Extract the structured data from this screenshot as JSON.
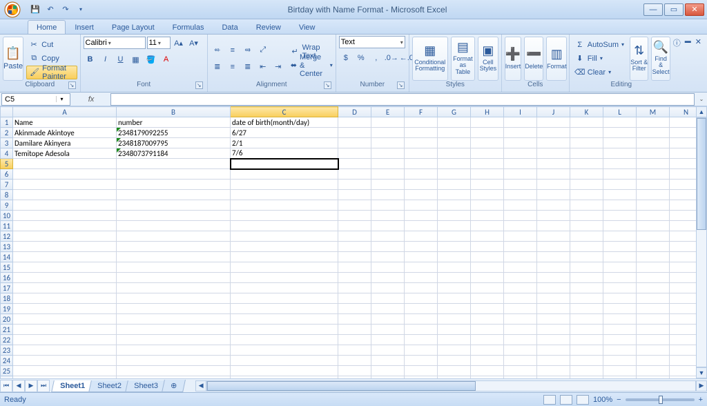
{
  "window": {
    "title": "Birtday with Name Format - Microsoft Excel"
  },
  "qat": {
    "save": "💾",
    "undo": "↶",
    "redo": "↷"
  },
  "tabs": [
    "Home",
    "Insert",
    "Page Layout",
    "Formulas",
    "Data",
    "Review",
    "View"
  ],
  "active_tab": "Home",
  "ribbon": {
    "clipboard": {
      "paste": "Paste",
      "cut": "Cut",
      "copy": "Copy",
      "format_painter": "Format Painter",
      "label": "Clipboard"
    },
    "font": {
      "name": "Calibri",
      "size": "11",
      "label": "Font"
    },
    "alignment": {
      "wrap": "Wrap Text",
      "merge": "Merge & Center",
      "label": "Alignment"
    },
    "number": {
      "format": "Text",
      "label": "Number"
    },
    "styles": {
      "cond": "Conditional Formatting",
      "table": "Format as Table",
      "cell": "Cell Styles",
      "label": "Styles"
    },
    "cells": {
      "insert": "Insert",
      "delete": "Delete",
      "format": "Format",
      "label": "Cells"
    },
    "editing": {
      "sum": "AutoSum",
      "fill": "Fill",
      "clear": "Clear",
      "sort": "Sort & Filter",
      "find": "Find & Select",
      "label": "Editing"
    }
  },
  "namebox": "C5",
  "columns": [
    "A",
    "B",
    "C",
    "D",
    "E",
    "F",
    "G",
    "H",
    "I",
    "J",
    "K",
    "L",
    "M",
    "N"
  ],
  "selected_col": "C",
  "selected_row": 5,
  "row_count": 27,
  "data": {
    "A1": "Name",
    "B1": "number",
    "C1": "date of birth(month/day)",
    "A2": "Akinmade Akintoye",
    "B2": "2348179092255",
    "C2": "6/27",
    "A3": "Damilare Akinyera",
    "B3": "2348187009795",
    "C3": "2/1",
    "A4": "Temitope Adesola",
    "B4": "2348073791184",
    "C4": "7/6"
  },
  "green_triangle_cells": [
    "B2",
    "B3",
    "B4"
  ],
  "sheets": [
    "Sheet1",
    "Sheet2",
    "Sheet3"
  ],
  "active_sheet": "Sheet1",
  "status": {
    "ready": "Ready",
    "zoom": "100%"
  },
  "chart_data": {
    "type": "table",
    "columns": [
      "Name",
      "number",
      "date of birth(month/day)"
    ],
    "rows": [
      [
        "Akinmade Akintoye",
        "2348179092255",
        "6/27"
      ],
      [
        "Damilare Akinyera",
        "2348187009795",
        "2/1"
      ],
      [
        "Temitope Adesola",
        "2348073791184",
        "7/6"
      ]
    ]
  }
}
